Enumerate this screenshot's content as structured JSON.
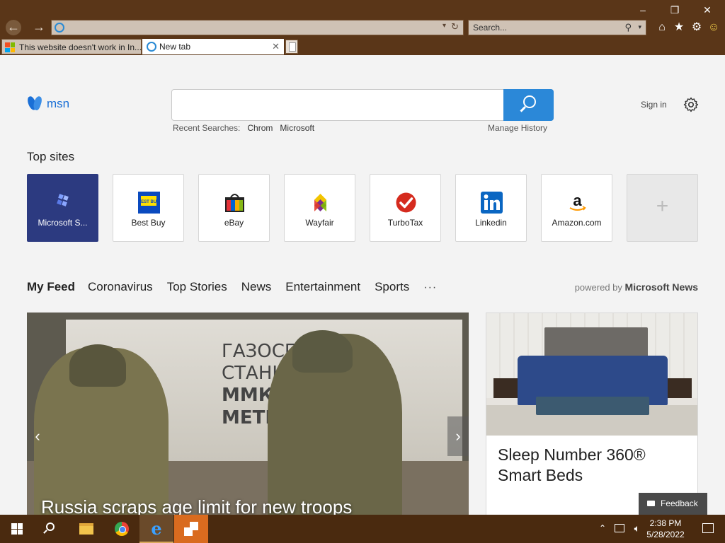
{
  "browser": {
    "search_placeholder": "Search...",
    "tabs": [
      {
        "label": "This website doesn't work in In..."
      },
      {
        "label": "New tab"
      }
    ],
    "window_controls": {
      "minimize": "‒",
      "restore": "❐",
      "close": "✕"
    }
  },
  "page": {
    "msn_label": "msn",
    "search": {
      "recent_label": "Recent Searches:",
      "recent_terms": [
        "Chrom",
        "Microsoft"
      ],
      "manage_history": "Manage History"
    },
    "sign_in": "Sign in",
    "top_sites": {
      "title": "Top sites",
      "tiles": [
        {
          "label": "Microsoft S..."
        },
        {
          "label": "Best Buy"
        },
        {
          "label": "eBay"
        },
        {
          "label": "Wayfair"
        },
        {
          "label": "TurboTax"
        },
        {
          "label": "Linkedin"
        },
        {
          "label": "Amazon.com"
        }
      ],
      "add_label": "+"
    },
    "feed": {
      "tabs": [
        "My Feed",
        "Coronavirus",
        "Top Stories",
        "News",
        "Entertainment",
        "Sports"
      ],
      "more": "···",
      "powered_by_prefix": "powered by",
      "powered_by_brand": "Microsoft News",
      "hero": {
        "caption": "Russia scraps age limit for new troops",
        "graffiti": [
          "ГАЗОСПАС   НАЯ",
          "СТАНЦИЯ",
          "ММК",
          "METI"
        ]
      },
      "ad": {
        "title": "Sleep Number 360® Smart Beds"
      }
    },
    "feedback": "Feedback"
  },
  "taskbar": {
    "time": "2:38 PM",
    "date": "5/28/2022"
  },
  "colors": {
    "chrome": "#5a3618",
    "taskbar": "#4a2a0f",
    "search_button": "#2b88d8",
    "ms_tile": "#2c3a80",
    "msn_blue": "#1a6fd6"
  }
}
